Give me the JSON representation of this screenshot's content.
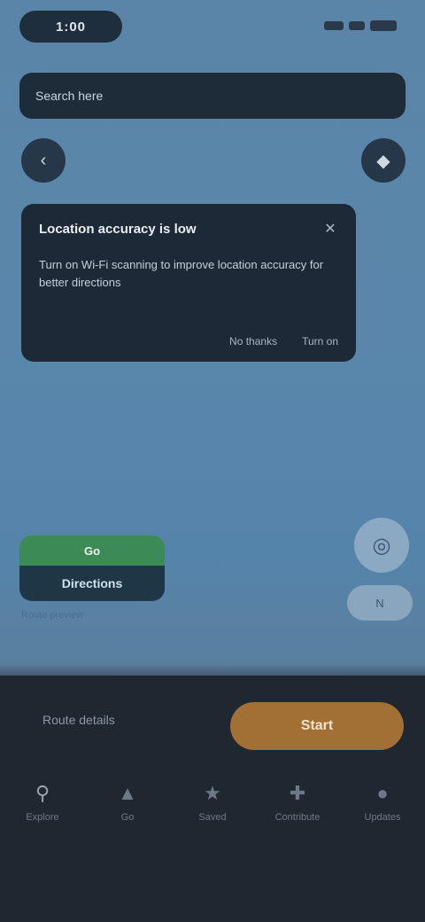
{
  "status_bar": {
    "time": "1:00",
    "icons": [
      "signal-icon",
      "wifi-icon",
      "battery-icon"
    ]
  },
  "banner": {
    "text": "Search here"
  },
  "controls": {
    "back_icon": "back-icon",
    "layers_icon": "layers-icon"
  },
  "tip_card": {
    "title": "Location accuracy is low",
    "body": "Turn on Wi‑Fi scanning to improve location accuracy for better directions",
    "close_icon": "close-icon",
    "dismiss_label": "No thanks",
    "action_label": "Turn on"
  },
  "go_card": {
    "top_label": "Go",
    "bottom_label": "Directions",
    "caption": "Route preview"
  },
  "map_buttons": {
    "locate_icon": "locate-icon",
    "compass_label": "N"
  },
  "bottom_panel": {
    "route_info": "Route details",
    "start_label": "Start"
  },
  "nav": [
    {
      "label": "Explore",
      "icon": "explore-icon"
    },
    {
      "label": "Go",
      "icon": "go-icon"
    },
    {
      "label": "Saved",
      "icon": "saved-icon"
    },
    {
      "label": "Contribute",
      "icon": "contribute-icon"
    },
    {
      "label": "Updates",
      "icon": "updates-icon"
    }
  ],
  "colors": {
    "accent": "#a26f34",
    "go_green": "#3c8a55",
    "panel": "#1f2731"
  }
}
